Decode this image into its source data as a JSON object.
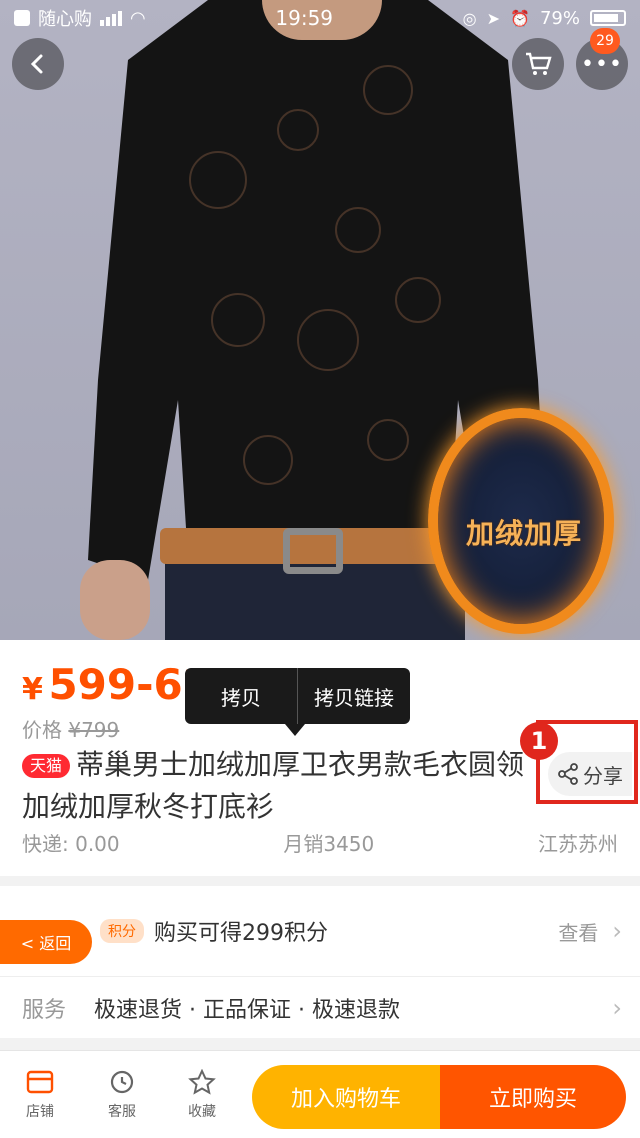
{
  "status_bar": {
    "carrier": "随心购",
    "time": "19:59",
    "battery": "79%"
  },
  "header": {
    "message_badge": "29"
  },
  "product_image": {
    "overlay_text": "加绒加厚"
  },
  "context_menu": {
    "copy": "拷贝",
    "copy_link": "拷贝链接"
  },
  "product": {
    "price_symbol": "¥",
    "price_range": "599-629",
    "original_price_label": "价格",
    "original_price": "¥799",
    "badge": "天猫",
    "title": "蒂巢男士加绒加厚卫衣男款毛衣圆领加绒加厚秋冬打底衫",
    "share_label": "分享",
    "shipping": "快递: 0.00",
    "monthly_sales": "月销3450",
    "location": "江苏苏州"
  },
  "annotation": {
    "step": "1"
  },
  "points_row": {
    "back_label": "< 返回",
    "tag": "积分",
    "text": "购买可得299积分",
    "action": "查看"
  },
  "service_row": {
    "label": "服务",
    "text": "极速退货 · 正品保证 · 极速退款"
  },
  "bottom_bar": {
    "store": "店铺",
    "service": "客服",
    "favorite": "收藏",
    "add_to_cart": "加入购物车",
    "buy_now": "立即购买"
  }
}
